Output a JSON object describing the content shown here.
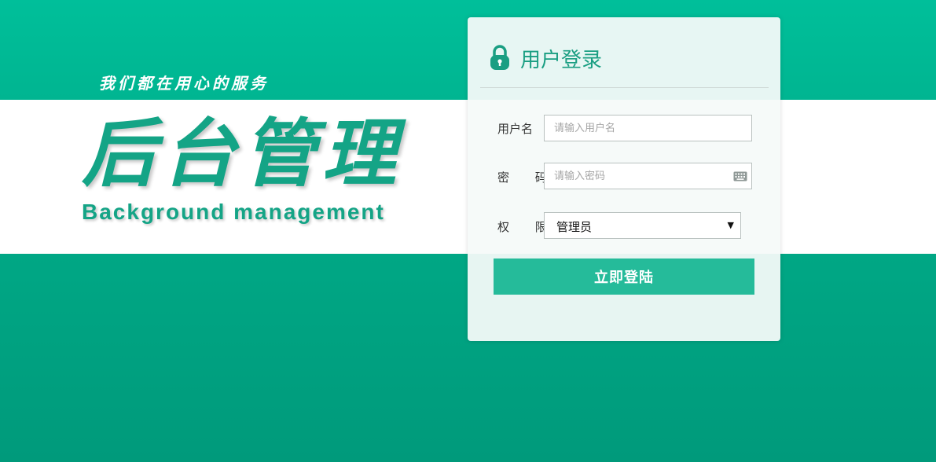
{
  "brand": {
    "tagline": "我们都在用心的服务",
    "title": "后台管理",
    "subtitle": "Background management"
  },
  "login": {
    "title": "用户登录",
    "lock_icon": "lock-icon",
    "username_label": "用户名",
    "username_placeholder": "请输入用户名",
    "password_label": "密 码",
    "password_placeholder": "请输入密码",
    "keyboard_icon": "keyboard-icon",
    "role_label": "权 限",
    "role_selected": "管理员",
    "submit_label": "立即登陆"
  },
  "colors": {
    "accent": "#14a486",
    "button": "#25bb9a",
    "background_top": "#00bf9a",
    "background_bottom": "#009a7b"
  }
}
